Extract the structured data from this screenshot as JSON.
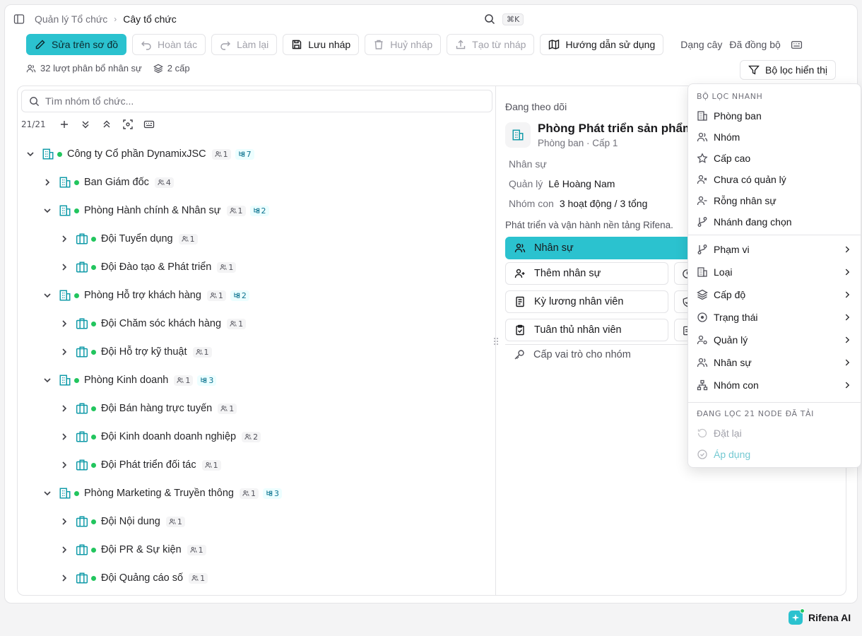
{
  "header": {
    "breadcrumb_parent": "Quản lý Tổ chức",
    "breadcrumb_current": "Cây tổ chức",
    "shortcut": "⌘K"
  },
  "toolbar": {
    "edit_label": "Sửa trên sơ đồ",
    "undo_label": "Hoàn tác",
    "redo_label": "Làm lại",
    "save_draft_label": "Lưu nháp",
    "discard_draft_label": "Huỷ nháp",
    "create_from_draft_label": "Tạo từ nháp",
    "guide_label": "Hướng dẫn sử dụng",
    "view_mode": "Dạng cây",
    "sync_status": "Đã đồng bộ"
  },
  "stats": {
    "allocations": "32 lượt phân bổ nhân sự",
    "levels": "2 cấp"
  },
  "filter_button_label": "Bộ lọc hiển thị",
  "search": {
    "placeholder": "Tìm nhóm tổ chức..."
  },
  "tree_count": "21/21",
  "tree": [
    {
      "label": "Công ty Cổ phần DynamixJSC",
      "level": 0,
      "expanded": true,
      "icon": "building-icon",
      "members": "1",
      "children": "7"
    },
    {
      "label": "Ban Giám đốc",
      "level": 1,
      "expanded": false,
      "icon": "building-icon",
      "members": "4",
      "children": ""
    },
    {
      "label": "Phòng Hành chính & Nhân sự",
      "level": 1,
      "expanded": true,
      "icon": "building-icon",
      "members": "1",
      "children": "2"
    },
    {
      "label": "Đội Tuyển dụng",
      "level": 2,
      "expanded": false,
      "icon": "team-icon",
      "members": "1",
      "children": ""
    },
    {
      "label": "Đội Đào tạo & Phát triển",
      "level": 2,
      "expanded": false,
      "icon": "team-icon",
      "members": "1",
      "children": ""
    },
    {
      "label": "Phòng Hỗ trợ khách hàng",
      "level": 1,
      "expanded": true,
      "icon": "building-icon",
      "members": "1",
      "children": "2"
    },
    {
      "label": "Đội Chăm sóc khách hàng",
      "level": 2,
      "expanded": false,
      "icon": "team-icon",
      "members": "1",
      "children": ""
    },
    {
      "label": "Đội Hỗ trợ kỹ thuật",
      "level": 2,
      "expanded": false,
      "icon": "team-icon",
      "members": "1",
      "children": ""
    },
    {
      "label": "Phòng Kinh doanh",
      "level": 1,
      "expanded": true,
      "icon": "building-icon",
      "members": "1",
      "children": "3"
    },
    {
      "label": "Đội Bán hàng trực tuyến",
      "level": 2,
      "expanded": false,
      "icon": "team-icon",
      "members": "1",
      "children": ""
    },
    {
      "label": "Đội Kinh doanh doanh nghiệp",
      "level": 2,
      "expanded": false,
      "icon": "team-icon",
      "members": "2",
      "children": ""
    },
    {
      "label": "Đội Phát triển đối tác",
      "level": 2,
      "expanded": false,
      "icon": "team-icon",
      "members": "1",
      "children": ""
    },
    {
      "label": "Phòng Marketing & Truyền thông",
      "level": 1,
      "expanded": true,
      "icon": "building-icon",
      "members": "1",
      "children": "3"
    },
    {
      "label": "Đội Nội dung",
      "level": 2,
      "expanded": false,
      "icon": "team-icon",
      "members": "1",
      "children": ""
    },
    {
      "label": "Đội PR & Sự kiện",
      "level": 2,
      "expanded": false,
      "icon": "team-icon",
      "members": "1",
      "children": ""
    },
    {
      "label": "Đội Quảng cáo số",
      "level": 2,
      "expanded": false,
      "icon": "team-icon",
      "members": "1",
      "children": ""
    }
  ],
  "panel": {
    "following_label": "Đang theo dõi",
    "title": "Phòng Phát triển sản phẩm",
    "subtitle": "Phòng ban · Cấp 1",
    "staff_label": "Nhân sự",
    "manager_label": "Quản lý",
    "manager_value": "Lê Hoàng Nam",
    "subgroups_label": "Nhóm con",
    "subgroups_value": "3 hoạt động / 3 tổng",
    "description": "Phát triển và vận hành nền tảng Rifena.",
    "tab_staff": "Nhân sự",
    "add_staff": "Thêm nhân sự",
    "payroll": "Kỳ lương nhân viên",
    "compliance": "Tuân thủ nhân viên",
    "assign_role": "Cấp vai trò cho nhóm"
  },
  "menu": {
    "quick_title": "BỘ LỌC NHANH",
    "quick_items": [
      "Phòng ban",
      "Nhóm",
      "Cấp cao",
      "Chưa có quản lý",
      "Rỗng nhân sự",
      "Nhánh đang chọn"
    ],
    "sub_items": [
      "Phạm vi",
      "Loại",
      "Cấp độ",
      "Trạng thái",
      "Quản lý",
      "Nhân sự",
      "Nhóm con"
    ],
    "status_title": "ĐANG LỌC 21 NODE ĐÃ TẢI",
    "reset_label": "Đặt lại",
    "apply_label": "Áp dụng"
  },
  "assistant_label": "Rifena AI",
  "colors": {
    "accent": "#2bc2cf",
    "active_dot": "#22c55e",
    "org_icon": "#0f9aa8"
  }
}
